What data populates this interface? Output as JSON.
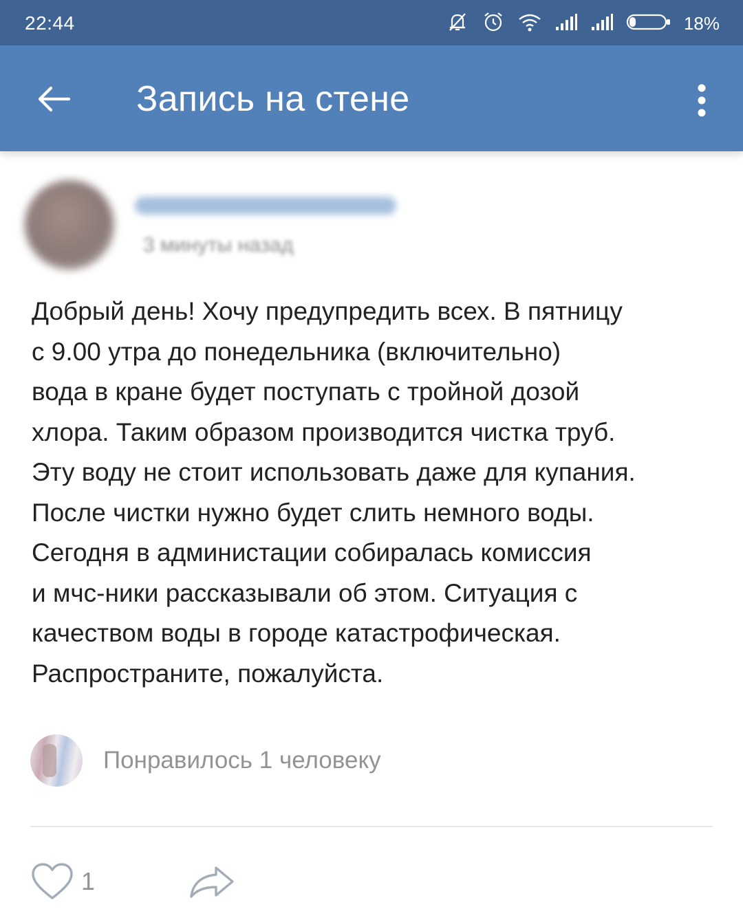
{
  "status_bar": {
    "time": "22:44",
    "battery_percent": "18%",
    "icons": [
      "bell-muted-icon",
      "alarm-icon",
      "wifi-icon",
      "signal-icon",
      "signal-icon",
      "battery-icon"
    ]
  },
  "app_bar": {
    "title": "Запись на стене",
    "back_icon": "arrow-left-icon",
    "menu_icon": "more-vertical-icon"
  },
  "post": {
    "author_name": "",
    "time": "3 минуты назад",
    "text_lines": [
      "Добрый день! Хочу предупредить всех. В пятницу",
      "с 9.00 утра до понедельника (включительно)",
      "вода в кране будет поступать с тройной дозой",
      "хлора. Таким образом производится чистка труб.",
      "Эту воду не стоит использовать даже для купания.",
      "После чистки нужно будет слить немного воды.",
      "Сегодня в администации собиралась комиссия",
      "и мчс-ники рассказывали об этом. Ситуация с",
      "качеством воды в городе катастрофическая.",
      "Распространите, пожалуйста."
    ],
    "likes_text": "Понравилось 1 человеку",
    "like_count": "1"
  },
  "colors": {
    "status_bar": "#3f6494",
    "app_bar": "#5181b8",
    "text": "#222222",
    "secondary_text": "#939393"
  }
}
